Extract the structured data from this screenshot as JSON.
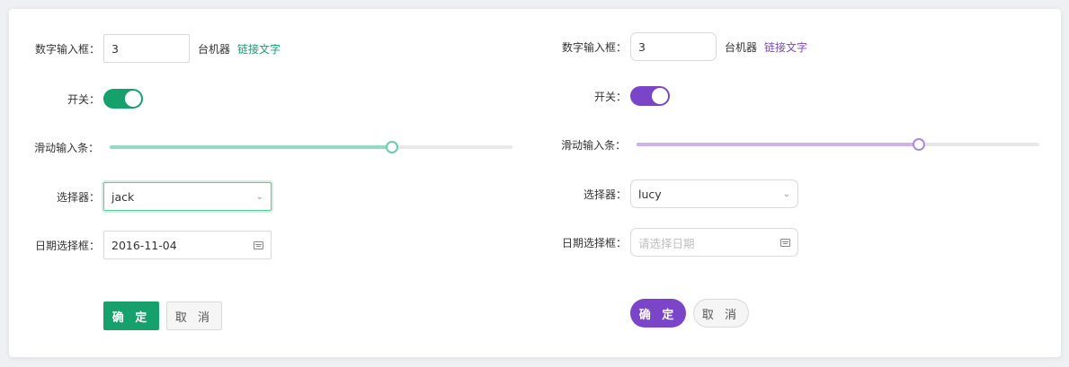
{
  "colors": {
    "green": "#16a06c",
    "purple": "#7b45c9"
  },
  "left": {
    "number_label": "数字输入框：",
    "number_value": "3",
    "unit": "台机器",
    "link": "链接文字",
    "switch_label": "开关：",
    "switch_on": true,
    "slider_label": "滑动输入条：",
    "slider_value": 0.7,
    "select_label": "选择器：",
    "select_value": "jack",
    "date_label": "日期选择框：",
    "date_value": "2016-11-04",
    "ok": "确 定",
    "cancel": "取 消"
  },
  "right": {
    "number_label": "数字输入框：",
    "number_value": "3",
    "unit": "台机器",
    "link": "链接文字",
    "switch_label": "开关：",
    "switch_on": true,
    "slider_label": "滑动输入条：",
    "slider_value": 0.7,
    "select_label": "选择器：",
    "select_value": "lucy",
    "date_label": "日期选择框：",
    "date_placeholder": "请选择日期",
    "ok": "确 定",
    "cancel": "取 消"
  }
}
